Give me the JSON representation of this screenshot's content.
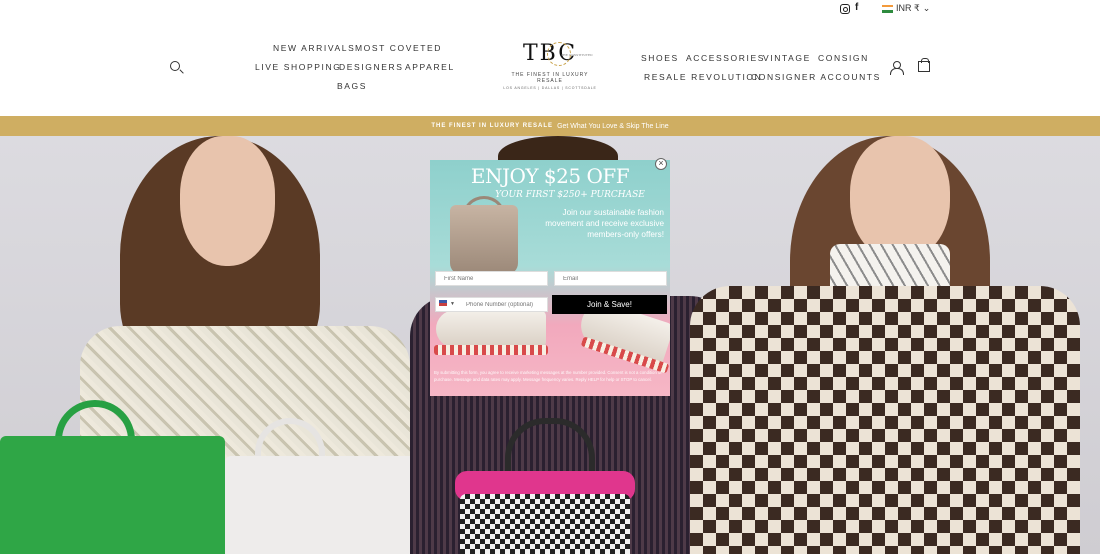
{
  "utility": {
    "instagram_icon": "instagram-icon",
    "facebook_icon": "facebook-icon",
    "currency": "INR ₹",
    "currency_caret": "⌄"
  },
  "nav": {
    "left": [
      "NEW ARRIVALS",
      "MOST COVETED",
      "LIVE SHOPPING",
      "DESIGNERS",
      "APPAREL",
      "BAGS"
    ],
    "right": [
      "SHOES",
      "ACCESSORIES",
      "VINTAGE",
      "CONSIGN",
      "RESALE REVOLUTION",
      "CONSIGNER ACCOUNTS"
    ]
  },
  "logo": {
    "mark": "TBC",
    "tagline": "THE FINEST IN LUXURY RESALE",
    "cities": "LOS ANGELES | DALLAS | SCOTTSDALE",
    "small": "THE CONSTITUTED"
  },
  "promo": {
    "bold": "THE FINEST IN LUXURY RESALE",
    "text": "Get What You Love & Skip The Line"
  },
  "popup": {
    "close": "×",
    "title": "ENJOY $25 OFF",
    "subtitle": "YOUR FIRST $250+ PURCHASE",
    "text": "Join our sustainable fashion movement and receive exclusive members-only offers!",
    "first_name_placeholder": "First Name",
    "email_placeholder": "Email",
    "phone_placeholder": "Phone Number (optional)",
    "button": "Join & Save!",
    "fine_print": "By submitting this form, you agree to receive marketing messages at the number provided. Consent is not a condition of purchase. Message and data rates may apply. Message frequency varies. Reply HELP for help or STOP to cancel."
  },
  "colors": {
    "promo_bar": "#cfae62",
    "popup_teal": "#8ed0cc",
    "popup_pink": "#f6b7c6",
    "button": "#000000"
  }
}
